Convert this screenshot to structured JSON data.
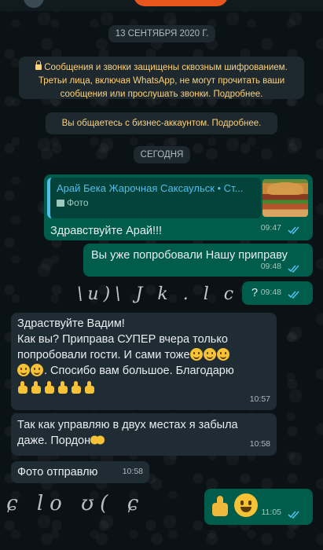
{
  "header": {
    "date_pill": "13 СЕНТЯБРЯ 2020 Г."
  },
  "encryption_notice": {
    "text": "Сообщения и звонки защищены сквозным шифрованием. Третьи лица, включая WhatsApp, не могут прочитать ваши сообщения или прослушать звонки. Подробнее."
  },
  "business_notice": {
    "text": "Вы общаетесь с бизнес-аккаунтом. Подробнее."
  },
  "today_pill": "СЕГОДНЯ",
  "messages": {
    "m1": {
      "reply_title": "Арай Бека Жарочная Саксаульск • Ст...",
      "reply_sub": "Фото",
      "text": "Здравствуйте Арай!!!",
      "time": "09:47"
    },
    "m2": {
      "text": "Вы уже попробовали Нашу приправу",
      "time": "09:48"
    },
    "m3": {
      "text": "?",
      "time": "09:48",
      "handwriting": "\\u)\\ J k . l c u b i"
    },
    "m4": {
      "text_line1": "Здраствуйте Вадим!",
      "text_line2": "Как вы? Приправа СУПЕР вчера только",
      "text_line3": "попробовали гости. И сами тоже",
      "text_line4": ". Спосибо вам большое. Благодарю",
      "time": "10:57"
    },
    "m5": {
      "text_line1": "Так как управляю в двух местах я забыла",
      "text_line2": "даже.  Пордон",
      "time": "10:58"
    },
    "m6": {
      "text": "Фото отправлю",
      "time": "10:58"
    },
    "m7": {
      "time": "11:05",
      "scribbles": "ɕ lo ʊ( ɕ"
    }
  },
  "colors": {
    "background": "#0b1216",
    "outgoing_bubble": "#005c4b",
    "incoming_bubble": "#1f2c34",
    "notice_text": "#ffd279",
    "read_ticks": "#53bdeb"
  },
  "icons": [
    "lock-icon",
    "photo-icon",
    "read-ticks-icon",
    "smile-emoji",
    "thumbs-up-emoji",
    "praying-hands-emoji"
  ]
}
